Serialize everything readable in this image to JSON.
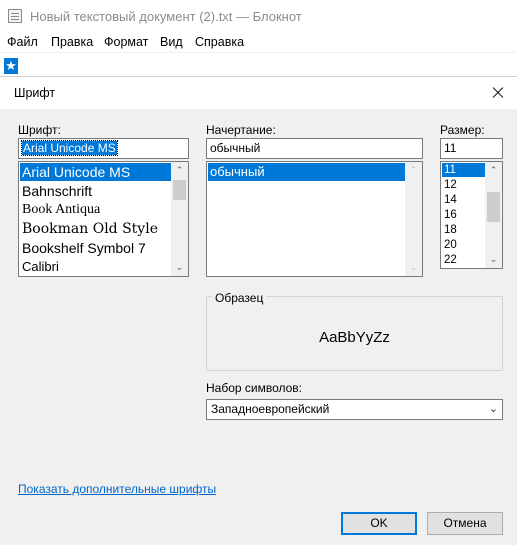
{
  "notepad": {
    "title": "Новый текстовый документ (2).txt — Блокнот",
    "menu": [
      "Файл",
      "Правка",
      "Формат",
      "Вид",
      "Справка"
    ],
    "text_selected": "★"
  },
  "dialog": {
    "title": "Шрифт",
    "font": {
      "label": "Шрифт:",
      "value": "Arial Unicode MS",
      "items": [
        "Arial Unicode MS",
        "Bahnschrift",
        "Book Antiqua",
        "Bookman Old Style",
        "Bookshelf Symbol 7",
        "Calibri"
      ],
      "selected_index": 0
    },
    "style": {
      "label": "Начертание:",
      "value": "обычный",
      "items": [
        "обычный"
      ],
      "selected_index": 0
    },
    "size": {
      "label": "Размер:",
      "value": "11",
      "items": [
        "11",
        "12",
        "14",
        "16",
        "18",
        "20",
        "22"
      ],
      "selected_index": 0
    },
    "sample": {
      "label": "Образец",
      "text": "AaBbYyZz"
    },
    "charset": {
      "label": "Набор символов:",
      "value": "Западноевропейский"
    },
    "more_fonts_link": "Показать дополнительные шрифты",
    "ok_label": "OK",
    "cancel_label": "Отмена"
  },
  "colors": {
    "accent": "#0078d7",
    "dialog_bg": "#f0f0f0",
    "link": "#0066cc"
  }
}
